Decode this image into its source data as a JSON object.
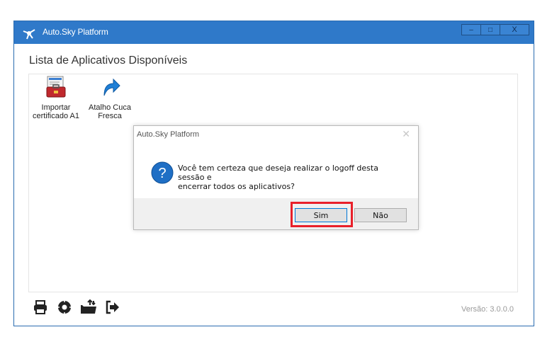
{
  "window": {
    "title": "Auto.Sky Platform",
    "minimize_label": "–",
    "maximize_label": "□",
    "close_label": "X"
  },
  "main": {
    "heading": "Lista de Aplicativos Disponíveis",
    "apps": [
      {
        "label_line1": "Importar",
        "label_line2": "certificado A1",
        "icon": "toolbox-certificate-icon"
      },
      {
        "label_line1": "Atalho Cuca",
        "label_line2": "Fresca",
        "icon": "shortcut-arrow-icon"
      }
    ]
  },
  "footer": {
    "icons": [
      "printer-icon",
      "gear-icon",
      "upload-folder-icon",
      "logout-icon"
    ],
    "version": "Versão: 3.0.0.0"
  },
  "dialog": {
    "title": "Auto.Sky Platform",
    "close_label": "✕",
    "message_line1": "Você tem certeza que deseja realizar o logoff desta sessão e",
    "message_line2": "encerrar todos os aplicativos?",
    "yes_label": "Sim",
    "no_label": "Não"
  },
  "colors": {
    "titlebar": "#2f79c9",
    "highlight": "#e8202a",
    "question_icon": "#1f6fc5"
  }
}
